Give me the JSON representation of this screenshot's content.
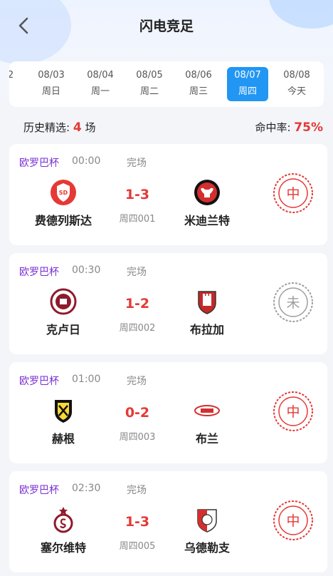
{
  "header": {
    "title": "闪电竞足"
  },
  "dates": [
    {
      "date": "2",
      "weekday": ""
    },
    {
      "date": "08/03",
      "weekday": "周日"
    },
    {
      "date": "08/04",
      "weekday": "周一"
    },
    {
      "date": "08/05",
      "weekday": "周二"
    },
    {
      "date": "08/06",
      "weekday": "周三"
    },
    {
      "date": "08/07",
      "weekday": "周四",
      "active": true
    },
    {
      "date": "08/08",
      "weekday": "今天"
    }
  ],
  "stats": {
    "history_label": "历史精选:",
    "history_count": "4",
    "history_unit": "场",
    "hit_label": "命中率:",
    "hit_rate": "75%"
  },
  "colors": {
    "accent": "#2196f3",
    "score": "#e53935",
    "league": "#7a2fd1",
    "stamp_hit": "#e53935",
    "stamp_pending": "#9e9e9e"
  },
  "matches": [
    {
      "league": "欧罗巴杯",
      "time": "00:00",
      "status": "完场",
      "home": "费德列斯达",
      "away": "米迪兰特",
      "score": "1-3",
      "code": "周四001",
      "result": "中",
      "home_logo": "red-round-crest",
      "away_logo": "black-bull-crest"
    },
    {
      "league": "欧罗巴杯",
      "time": "00:30",
      "status": "完场",
      "home": "克卢日",
      "away": "布拉加",
      "score": "1-2",
      "code": "周四002",
      "result": "未",
      "home_logo": "maroon-round-crest",
      "away_logo": "red-castle-shield"
    },
    {
      "league": "欧罗巴杯",
      "time": "01:00",
      "status": "完场",
      "home": "赫根",
      "away": "布兰",
      "score": "0-2",
      "code": "周四003",
      "result": "中",
      "home_logo": "yellow-black-shield",
      "away_logo": "brann-oval-crest"
    },
    {
      "league": "欧罗巴杯",
      "time": "02:30",
      "status": "完场",
      "home": "塞尔维特",
      "away": "乌德勒支",
      "score": "1-3",
      "code": "周四005",
      "result": "中",
      "home_logo": "maroon-star-crest",
      "away_logo": "utrecht-shield"
    }
  ]
}
